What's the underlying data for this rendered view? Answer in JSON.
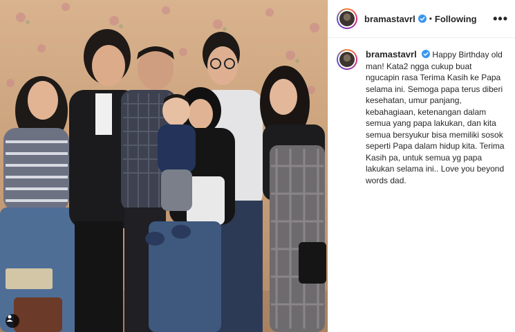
{
  "post": {
    "username": "bramastavrl",
    "separator": "•",
    "follow_status": "Following",
    "more_label": "•••",
    "caption": "Happy Birthday old man! Kata2 ngga cukup buat ngucapin rasa Terima Kasih ke Papa selama ini. Semoga papa terus diberi kesehatan, umur panjang, kebahagiaan, ketenangan dalam semua yang papa lakukan, dan kita semua bersyukur bisa memiliki sosok seperti Papa dalam hidup kita. Terima Kasih pa, untuk semua yg papa lakukan selama ini.. Love you beyond words dad."
  },
  "icons": {
    "verified": "verified-badge-icon",
    "more": "more-options-icon",
    "user_tag": "user-tag-icon"
  },
  "colors": {
    "verified_blue": "#3897f0",
    "text": "#262626",
    "border": "#efefef"
  }
}
